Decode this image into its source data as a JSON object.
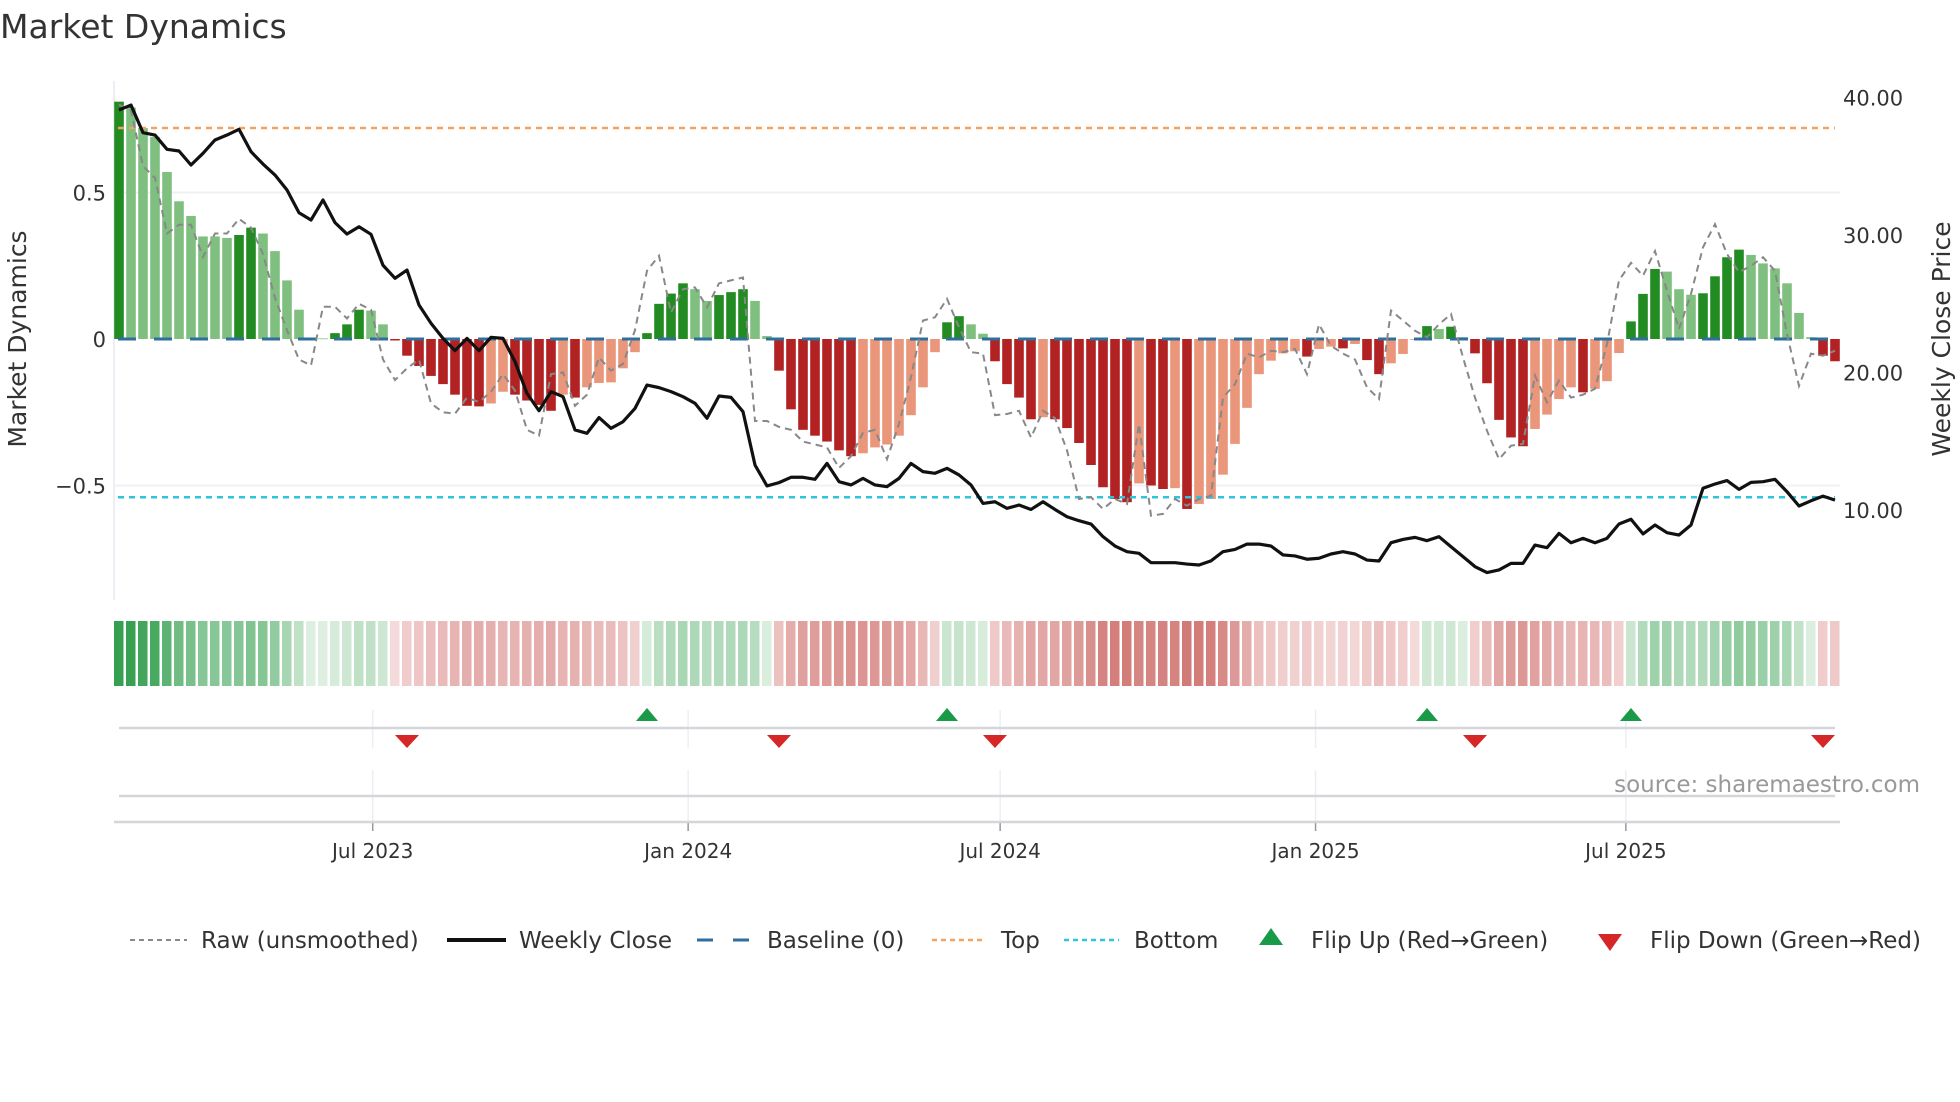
{
  "chart_data": {
    "type": "bar",
    "title": "Market Dynamics",
    "ylabel": "Market Dynamics",
    "y2label": "Weekly Close Price",
    "ylim": [
      -0.9,
      0.87
    ],
    "y2lim": [
      3.5,
      41.3
    ],
    "yticks": [
      {
        "v": 0.5,
        "label": "0.5"
      },
      {
        "v": 0,
        "label": "0"
      },
      {
        "v": -0.5,
        "label": "−0.5"
      }
    ],
    "y2ticks": [
      {
        "v": 40,
        "label": "40.00"
      },
      {
        "v": 30,
        "label": "30.00"
      },
      {
        "v": 20,
        "label": "20.00"
      },
      {
        "v": 10,
        "label": "10.00"
      }
    ],
    "xticks": [
      {
        "date": "2023-07-01",
        "label": "Jul 2023"
      },
      {
        "date": "2024-01-01",
        "label": "Jan 2024"
      },
      {
        "date": "2024-07-01",
        "label": "Jul 2024"
      },
      {
        "date": "2025-01-01",
        "label": "Jan 2025"
      },
      {
        "date": "2025-07-01",
        "label": "Jul 2025"
      }
    ],
    "start_date": "2023-02-03",
    "interval_days": 7,
    "top_level": 0.72,
    "bottom_level": -0.54,
    "baseline": 0,
    "values": [
      0.81,
      0.79,
      0.72,
      0.69,
      0.57,
      0.47,
      0.42,
      0.35,
      0.35,
      0.345,
      0.355,
      0.38,
      0.36,
      0.3,
      0.2,
      0.1,
      0.003,
      0.002,
      0.02,
      0.05,
      0.1,
      0.097,
      0.05,
      -0.005,
      -0.057,
      -0.092,
      -0.126,
      -0.154,
      -0.19,
      -0.228,
      -0.23,
      -0.22,
      -0.18,
      -0.19,
      -0.21,
      -0.225,
      -0.245,
      -0.19,
      -0.2,
      -0.165,
      -0.15,
      -0.148,
      -0.1,
      -0.045,
      0.02,
      0.12,
      0.155,
      0.19,
      0.17,
      0.13,
      0.15,
      0.16,
      0.17,
      0.13,
      0.01,
      -0.108,
      -0.24,
      -0.31,
      -0.33,
      -0.35,
      -0.38,
      -0.4,
      -0.39,
      -0.37,
      -0.36,
      -0.33,
      -0.26,
      -0.165,
      -0.045,
      0.057,
      0.078,
      0.05,
      0.018,
      -0.076,
      -0.154,
      -0.2,
      -0.274,
      -0.267,
      -0.274,
      -0.304,
      -0.355,
      -0.43,
      -0.506,
      -0.546,
      -0.557,
      -0.493,
      -0.5,
      -0.512,
      -0.509,
      -0.58,
      -0.563,
      -0.546,
      -0.463,
      -0.358,
      -0.235,
      -0.12,
      -0.074,
      -0.049,
      -0.042,
      -0.06,
      -0.034,
      -0.026,
      -0.032,
      -0.017,
      -0.072,
      -0.12,
      -0.083,
      -0.051,
      -0.003,
      0.044,
      0.034,
      0.042,
      0.006,
      -0.049,
      -0.151,
      -0.276,
      -0.336,
      -0.366,
      -0.307,
      -0.258,
      -0.205,
      -0.165,
      -0.182,
      -0.17,
      -0.144,
      -0.048,
      0.06,
      0.154,
      0.239,
      0.23,
      0.17,
      0.151,
      0.156,
      0.214,
      0.279,
      0.305,
      0.287,
      0.258,
      0.241,
      0.19,
      0.089,
      0.006,
      -0.057,
      -0.076
    ],
    "raw": [
      0.8,
      0.78,
      0.59,
      0.55,
      0.36,
      0.39,
      0.39,
      0.28,
      0.36,
      0.36,
      0.41,
      0.38,
      0.29,
      0.14,
      0.03,
      -0.07,
      -0.09,
      0.11,
      0.11,
      0.07,
      0.12,
      0.1,
      -0.07,
      -0.14,
      -0.1,
      -0.07,
      -0.22,
      -0.25,
      -0.255,
      -0.2,
      -0.215,
      -0.18,
      -0.12,
      -0.176,
      -0.31,
      -0.33,
      -0.12,
      -0.114,
      -0.228,
      -0.19,
      -0.063,
      -0.108,
      -0.085,
      0.03,
      0.233,
      0.284,
      0.09,
      0.17,
      0.176,
      0.108,
      0.19,
      0.2,
      0.21,
      -0.28,
      -0.28,
      -0.3,
      -0.31,
      -0.35,
      -0.36,
      -0.37,
      -0.44,
      -0.4,
      -0.32,
      -0.31,
      -0.41,
      -0.29,
      -0.13,
      0.063,
      0.074,
      0.137,
      0.04,
      -0.045,
      -0.05,
      -0.26,
      -0.256,
      -0.245,
      -0.336,
      -0.245,
      -0.27,
      -0.38,
      -0.546,
      -0.54,
      -0.58,
      -0.546,
      -0.563,
      -0.29,
      -0.603,
      -0.597,
      -0.546,
      -0.569,
      -0.546,
      -0.535,
      -0.2,
      -0.154,
      -0.05,
      -0.063,
      -0.04,
      -0.045,
      -0.034,
      -0.12,
      0.05,
      -0.023,
      -0.05,
      -0.07,
      -0.165,
      -0.205,
      0.097,
      0.063,
      0.028,
      0.006,
      0.05,
      0.085,
      -0.063,
      -0.2,
      -0.313,
      -0.41,
      -0.364,
      -0.358,
      -0.125,
      -0.216,
      -0.142,
      -0.2,
      -0.19,
      -0.17,
      -0.017,
      0.2,
      0.26,
      0.216,
      0.3,
      0.165,
      0.034,
      0.154,
      0.313,
      0.392,
      0.29,
      0.228,
      0.25,
      0.279,
      0.233,
      0.017,
      -0.16,
      -0.05,
      -0.057,
      -0.04
    ],
    "close": [
      39.09,
      39.45,
      37.44,
      37.27,
      36.23,
      36.11,
      35.09,
      35.94,
      36.91,
      37.27,
      37.69,
      36.06,
      35.16,
      34.36,
      33.27,
      31.62,
      31.09,
      32.55,
      30.9,
      30.07,
      30.6,
      30.05,
      27.8,
      26.85,
      27.45,
      24.91,
      23.58,
      22.48,
      21.59,
      22.48,
      21.59,
      22.56,
      22.48,
      20.79,
      18.48,
      17.22,
      18.61,
      18.24,
      15.82,
      15.58,
      16.72,
      15.94,
      16.42,
      17.39,
      19.09,
      18.9,
      18.61,
      18.24,
      17.76,
      16.67,
      18.29,
      18.19,
      17.15,
      13.27,
      11.75,
      11.99,
      12.38,
      12.38,
      12.23,
      13.39,
      12.06,
      11.82,
      12.3,
      11.82,
      11.7,
      12.3,
      13.39,
      12.79,
      12.67,
      13.03,
      12.55,
      11.82,
      10.48,
      10.6,
      10.12,
      10.36,
      10.04,
      10.6,
      10.04,
      9.51,
      9.22,
      8.98,
      8.06,
      7.38,
      6.97,
      6.85,
      6.17,
      6.17,
      6.17,
      6.07,
      6.0,
      6.3,
      6.97,
      7.13,
      7.52,
      7.52,
      7.38,
      6.73,
      6.66,
      6.42,
      6.49,
      6.8,
      6.97,
      6.8,
      6.36,
      6.29,
      7.62,
      7.86,
      8.01,
      7.77,
      8.06,
      7.33,
      6.61,
      5.88,
      5.45,
      5.64,
      6.12,
      6.12,
      7.45,
      7.26,
      8.3,
      7.62,
      7.94,
      7.62,
      7.94,
      8.98,
      9.33,
      8.26,
      8.91,
      8.35,
      8.18,
      8.91,
      11.58,
      11.89,
      12.14,
      11.5,
      12.01,
      12.06,
      12.23,
      11.33,
      10.29,
      10.67,
      11.01,
      10.72
    ],
    "flips_up": [
      "2023-12-08",
      "2024-05-31",
      "2025-03-07",
      "2025-07-04"
    ],
    "flips_down": [
      "2023-07-21",
      "2024-02-23",
      "2024-06-28",
      "2025-04-04",
      "2025-10-24"
    ],
    "legend": [
      {
        "key": "raw",
        "label": "Raw (unsmoothed)"
      },
      {
        "key": "close",
        "label": "Weekly Close"
      },
      {
        "key": "baseline",
        "label": "Baseline (0)"
      },
      {
        "key": "top",
        "label": "Top"
      },
      {
        "key": "bottom",
        "label": "Bottom"
      },
      {
        "key": "flip_up",
        "label": "Flip Up (Red→Green)"
      },
      {
        "key": "flip_down",
        "label": "Flip Down (Green→Red)"
      }
    ],
    "legend_position": "bottom",
    "colors": {
      "green_strong": "#228b22",
      "green_weak": "#7fbf7f",
      "red_strong": "#b22222",
      "red_weak": "#e9967a",
      "baseline": "#2e6f9e",
      "top": "#f4a261",
      "bottom": "#2ec4dc",
      "raw": "#888888",
      "close": "#111111",
      "flip_up": "#1a9a48",
      "flip_down": "#d62728"
    }
  },
  "source": "source: sharemaestro.com"
}
